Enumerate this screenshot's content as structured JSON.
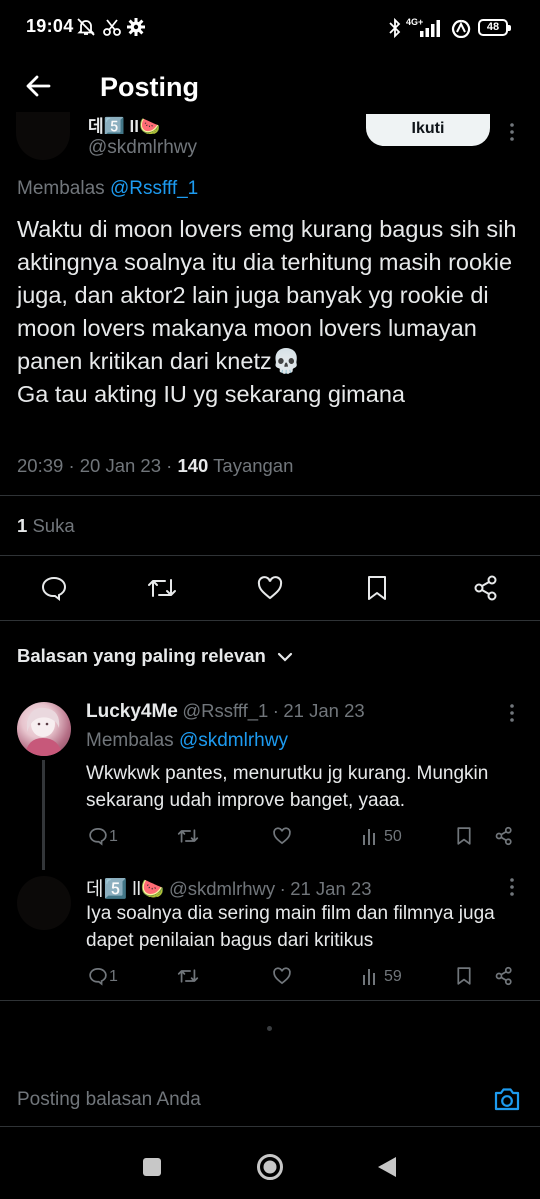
{
  "status_bar": {
    "time": "19:04",
    "battery": "48",
    "network": "4G+"
  },
  "header": {
    "back_icon": "arrow-left-icon",
    "title": "Posting"
  },
  "main_post": {
    "author_name": "데5️⃣ ll🍉",
    "author_handle": "@skdmlrhwy",
    "follow_label": "Ikuti",
    "reply_prefix": "Membalas",
    "reply_to": "@Rssfff_1",
    "text": "Waktu di moon lovers emg kurang bagus sih sih aktingnya soalnya itu dia terhitung masih rookie juga, dan aktor2 lain juga banyak yg rookie di moon lovers makanya moon lovers lumayan panen kritikan dari knetz💀\nGa tau akting IU yg sekarang gimana",
    "time": "20:39",
    "date": "20 Jan 23",
    "views_count": "140",
    "views_label": "Tayangan",
    "likes_count": "1",
    "likes_label": "Suka"
  },
  "sort": {
    "label": "Balasan yang paling relevan"
  },
  "replies": [
    {
      "name": "Lucky4Me",
      "handle": "@Rssfff_1",
      "date": "21 Jan 23",
      "reply_prefix": "Membalas",
      "reply_to": "@skdmlrhwy",
      "text": "Wkwkwk pantes, menurutku jg kurang. Mungkin sekarang udah improve banget, yaaa.",
      "reply_count": "1",
      "views": "50"
    },
    {
      "name": "데5️⃣ ll🍉",
      "handle": "@skdmlrhwy",
      "date": "21 Jan 23",
      "text": "Iya soalnya dia sering main film dan filmnya juga dapet penilaian bagus dari kritikus",
      "reply_count": "1",
      "views": "59"
    }
  ],
  "composer": {
    "placeholder": "Posting balasan Anda",
    "camera_icon": "camera-icon"
  },
  "colors": {
    "background": "#000000",
    "text": "#e7e9ea",
    "muted": "#71767b",
    "link": "#1d9bf0",
    "divider": "#2f3336"
  }
}
